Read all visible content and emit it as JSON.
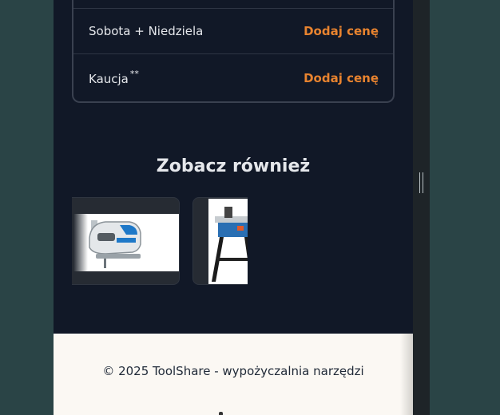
{
  "pricing": {
    "rows": [
      {
        "label": "Sobota + Niedziela",
        "superscript": "",
        "action": "Dodaj cenę"
      },
      {
        "label": "Kaucja",
        "superscript": "**",
        "action": "Dodaj cenę"
      }
    ]
  },
  "related": {
    "title": "Zobacz również",
    "items": [
      {
        "icon": "jigsaw-tool-image"
      },
      {
        "icon": "table-saw-image"
      }
    ]
  },
  "footer": {
    "copyright": "© 2025 ToolShare - wypożyczalnia narzędzi"
  },
  "colors": {
    "page_background": "#2a4446",
    "panel_background": "#111827",
    "accent": "#e8832f",
    "footer_background": "#fbf8f3"
  }
}
